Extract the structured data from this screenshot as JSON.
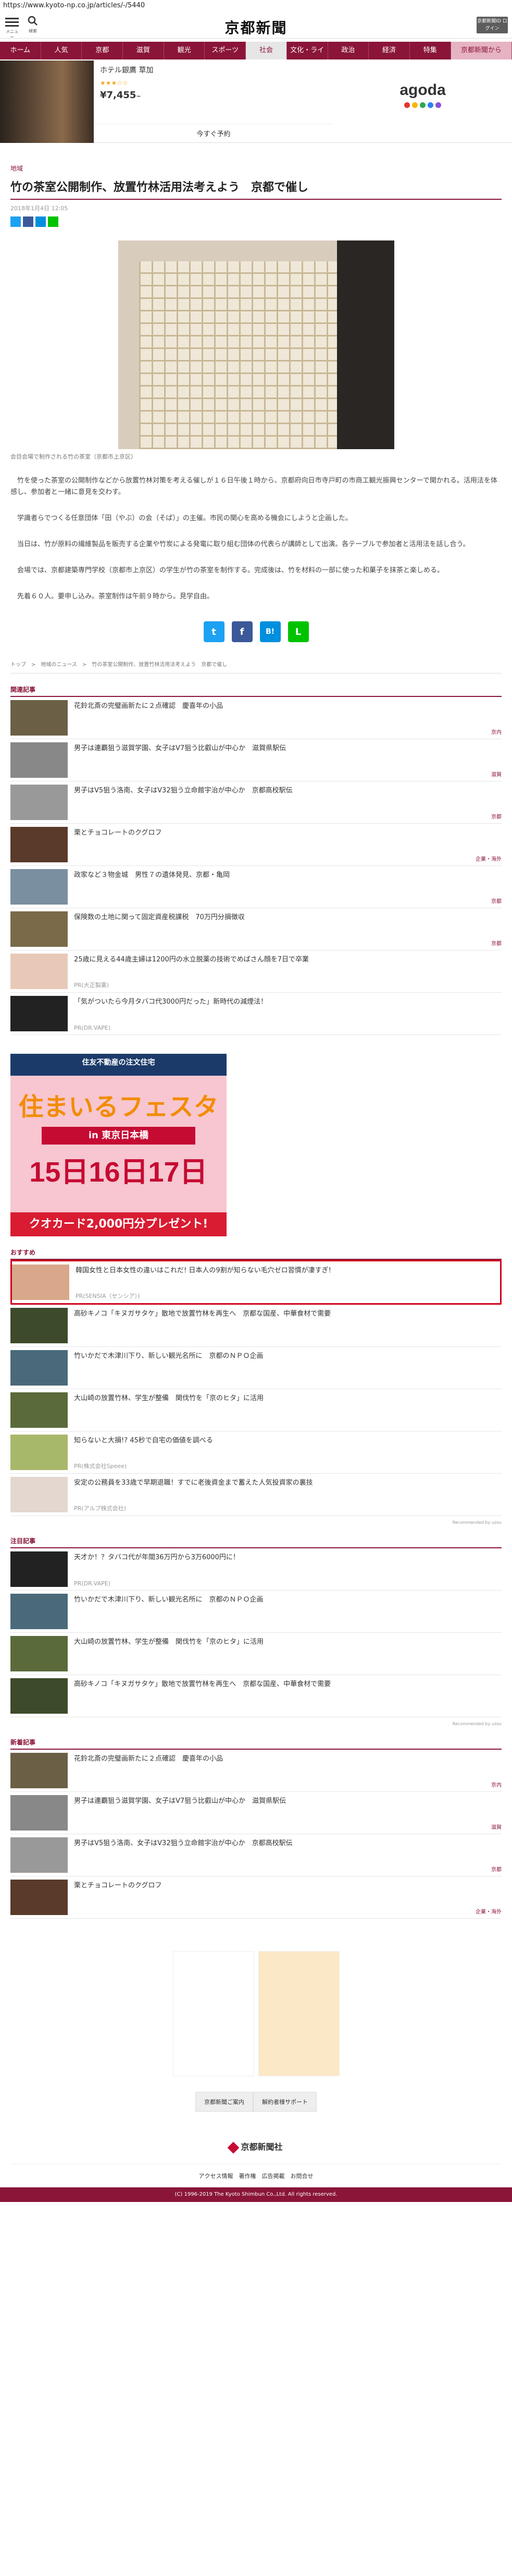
{
  "url": "https://www.kyoto-np.co.jp/articles/-/5440",
  "header": {
    "menu_label": "メニュー",
    "search_label": "検索",
    "logo": "京都新聞",
    "id_button": "京都新聞ID ログイン"
  },
  "nav": [
    "ホーム",
    "人気",
    "京都",
    "滋賀",
    "観光",
    "スポーツ",
    "社会",
    "文化・ライフ",
    "政治",
    "経済",
    "特集",
    "京都新聞から"
  ],
  "ad_top": {
    "hotel": "ホテル銀鷹 草加",
    "stars": "★★★☆☆",
    "price": "¥7,455",
    "price_unit": "~",
    "book": "今すぐ予約",
    "brand": "agoda",
    "dot_colors": [
      "#e5352b",
      "#f7b500",
      "#2fa84f",
      "#2d7ff9",
      "#8c4fd6"
    ]
  },
  "article": {
    "category": "地域",
    "title": "竹の茶室公開制作、放置竹林活用法考えよう　京都で催し",
    "date": "2018年1月4日 12:05",
    "caption": "会目会場で制作される竹の茶室（京都市上京区）",
    "paragraphs": [
      "竹を使った茶室の公開制作などから放置竹林対策を考える催しが１６日午後１時から、京都府向日市寺戸町の市商工観光振興センターで開かれる。活用法を体感し、参加者と一緒に意見を交わす。",
      "学識者らでつくる任意団体「田（やぶ）の会（そば）」の主催。市民の関心を高める機会にしようと企画した。",
      "当日は、竹が原料の繊維製品を販売する企業や竹炭による発電に取り組む団体の代表らが講師として出演。各テーブルで参加者と活用法を話し合う。",
      "会場では、京都建築専門学校（京都市上京区）の学生が竹の茶室を制作する。完成後は、竹を材料の一部に使った和菓子を抹茶と楽しめる。",
      "先着６０人。要申し込み。茶室制作は午前９時から。見学自由。"
    ],
    "breadcrumb": "トップ　>　地域のニュース　>　竹の茶室公開制作、放置竹林活用法考えよう　京都で催し"
  },
  "share_large": [
    "t",
    "f",
    "B!",
    "L"
  ],
  "related": {
    "heading": "関連記事",
    "items": [
      {
        "title": "花鈴北斎の完璧画新たに２点確認　慶喜年の小品",
        "tag": "京内",
        "thumb": "#6b6046"
      },
      {
        "title": "男子は連覇狙う滋賀学園、女子はV7狙う比叡山が中心か　滋賀県駅伝",
        "tag": "滋賀",
        "thumb": "#888"
      },
      {
        "title": "男子はV5狙う洛南、女子はV32狙う立命館宇治が中心か　京都高校駅伝",
        "tag": "京都",
        "thumb": "#999"
      },
      {
        "title": "栗とチョコレートのクグロフ",
        "tag": "企業・海外",
        "thumb": "#5a3a2a"
      },
      {
        "title": "政家など３物金城　男性７の遺体発見、京都・亀岡",
        "tag": "京都",
        "thumb": "#7a8fa0"
      },
      {
        "title": "保険数の土地に関って固定資産税課税　70万円分損徴収",
        "tag": "京都",
        "thumb": "#7a6a4a"
      },
      {
        "title": "25歳に見える44歳主婦は1200円の水立脱薬の技術でめばさん顔を7日で卒業",
        "pr": "PR(大正製薬)",
        "thumb": "#e8c9b7"
      },
      {
        "title": "「気がついたら今月タバコ代3000円だった」新時代の減煙法！",
        "pr": "PR(DR.VAPE)",
        "thumb": "#222"
      }
    ]
  },
  "box_ad": {
    "top": "住友不動産の注文住宅",
    "main": "住まいるフェスタ",
    "venue": "in 東京日本橋",
    "dates": "15日16日17日",
    "bottom": "クオカード2,000円分プレゼント!"
  },
  "recommend": {
    "heading": "おすすめ",
    "items": [
      {
        "title": "韓国女性と日本女性の違いはこれだ! 日本人の9割が知らない毛穴ゼロ習慣が凄すぎ!",
        "pr": "PR(SENSIA（センシア）)",
        "thumb": "#d9a78a",
        "highlight": true
      },
      {
        "title": "高砂キノコ「キヌガサタケ」散地で放置竹林を再生へ　京都な国産、中華食材で需要",
        "thumb": "#3d4b2a"
      },
      {
        "title": "竹いかだで木津川下り、新しい観光名所に　京都のＮＰＯ企画",
        "thumb": "#4a6a7a"
      },
      {
        "title": "大山崎の放置竹林、学生が整備　関伐竹を「京のヒタ」に活用",
        "thumb": "#5a6a3a"
      },
      {
        "title": "知らないと大損!? 45秒で自宅の価値を調べる",
        "pr": "PR(株式会社Speee)",
        "thumb": "#a8b86a"
      },
      {
        "title": "安定の公務員を33歳で早期退職！すでに老後資金まで蓄えた人気投資家の裏技",
        "pr": "PR(アルプ株式会社)",
        "thumb": "#e3d7cf"
      }
    ],
    "brand": "Recommended by uzou"
  },
  "popular": {
    "heading": "注目記事",
    "items": [
      {
        "title": "天才か！？タバコ代が年間36万円から3万6000円に！",
        "pr": "PR(DR.VAPE)",
        "thumb": "#222"
      },
      {
        "title": "竹いかだで木津川下り、新しい観光名所に　京都のＮＰＯ企画",
        "thumb": "#4a6a7a"
      },
      {
        "title": "大山崎の放置竹林、学生が整備　関伐竹を「京のヒタ」に活用",
        "thumb": "#5a6a3a"
      },
      {
        "title": "高砂キノコ「キヌガサタケ」散地で放置竹林を再生へ　京都な国産、中華食材で需要",
        "thumb": "#3d4b2a"
      }
    ],
    "brand": "Recommended by uzou"
  },
  "latest": {
    "heading": "新着記事",
    "items": [
      {
        "title": "花鈴北斎の完璧画新たに２点確認　慶喜年の小品",
        "tag": "京内",
        "thumb": "#6b6046"
      },
      {
        "title": "男子は連覇狙う滋賀学園、女子はV7狙う比叡山が中心か　滋賀県駅伝",
        "tag": "滋賀",
        "thumb": "#888"
      },
      {
        "title": "男子はV5狙う洛南、女子はV32狙う立命館宇治が中心か　京都高校駅伝",
        "tag": "京都",
        "thumb": "#999"
      },
      {
        "title": "栗とチョコレートのクグロフ",
        "tag": "企業・海外",
        "thumb": "#5a3a2a"
      }
    ]
  },
  "footer": {
    "btn1": "京都新聞ご案内",
    "btn2": "解約者様サポート",
    "logo": "京都新聞社",
    "links": "アクセス情報　著作権　広告掲載　お問合せ",
    "copyright": "(C) 1996-2019 The Kyoto Shimbun Co.,Ltd. All rights reserved."
  }
}
